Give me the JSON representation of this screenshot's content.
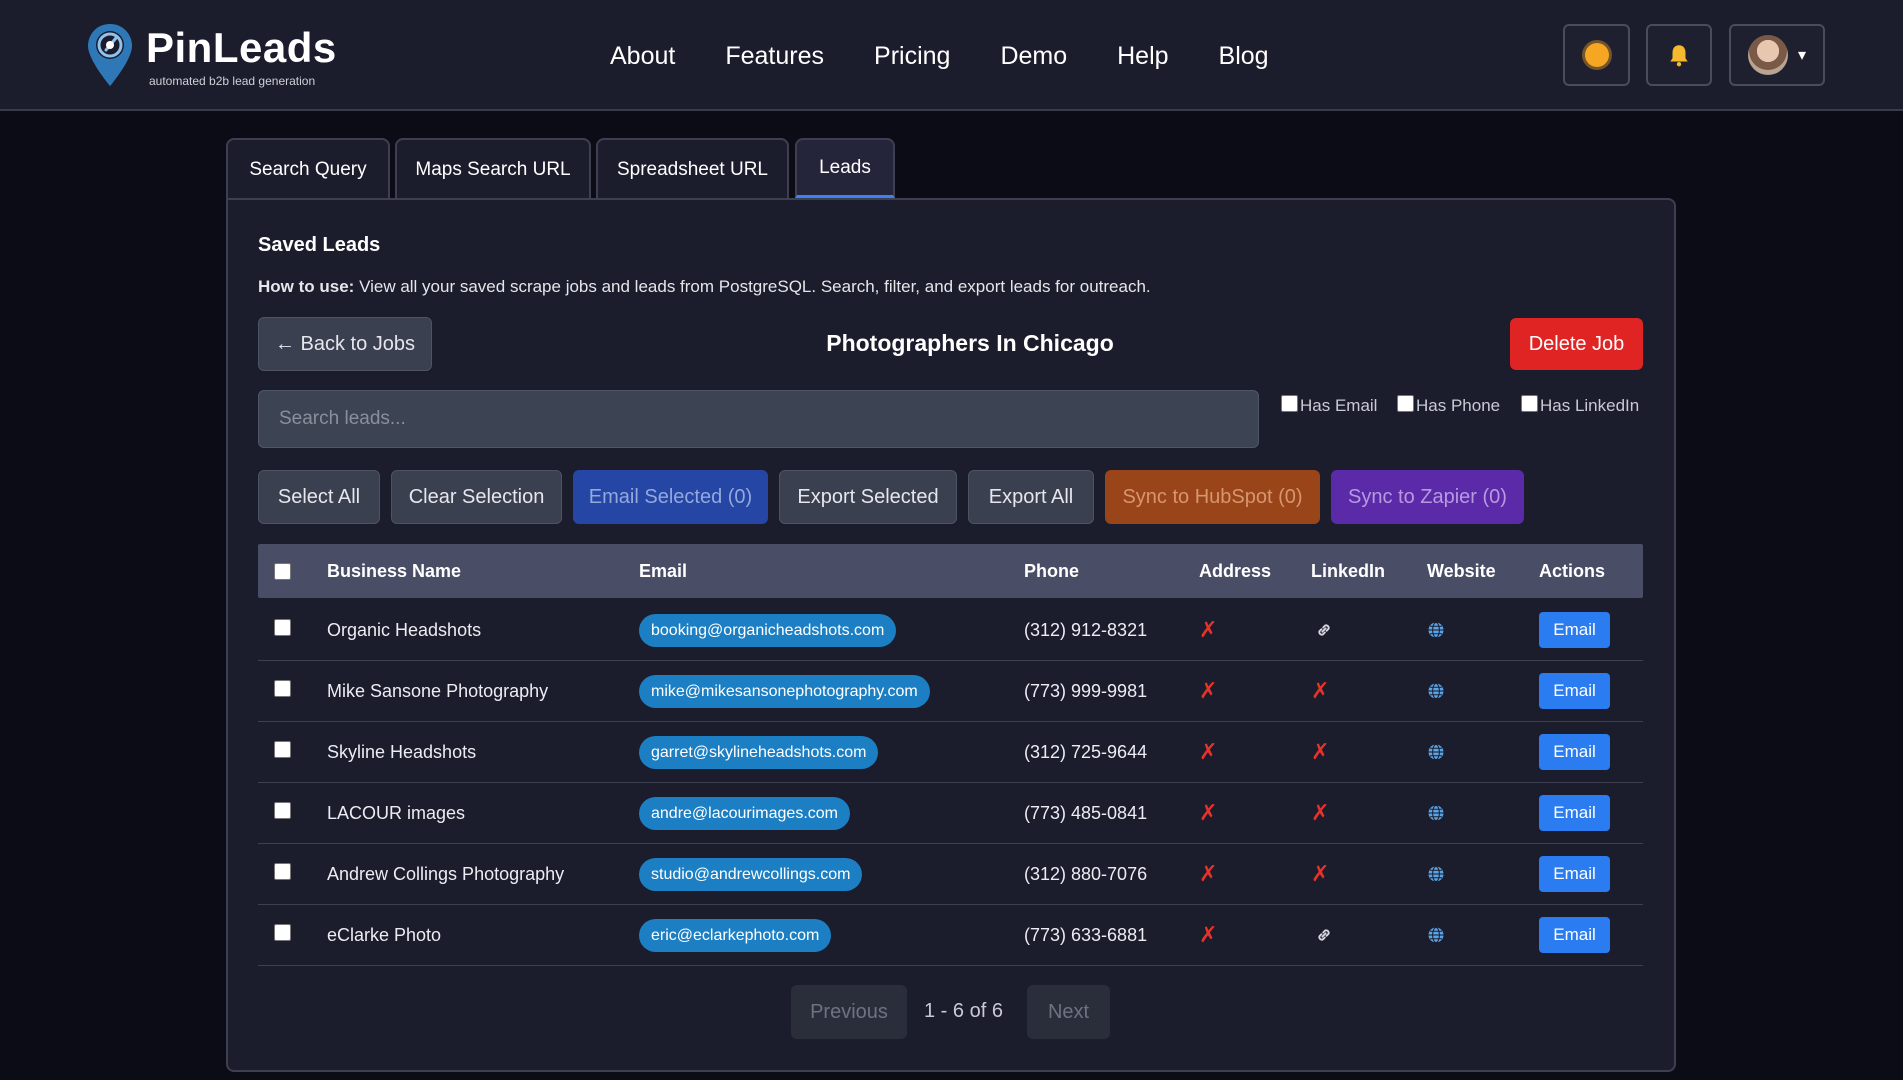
{
  "brand": {
    "name": "PinLeads",
    "tagline": "automated b2b lead generation"
  },
  "nav": [
    "About",
    "Features",
    "Pricing",
    "Demo",
    "Help",
    "Blog"
  ],
  "header_icons": {
    "theme": "sun-icon",
    "notifications": "bell-icon",
    "user_caret": "▾"
  },
  "tabs": [
    {
      "label": "Search Query"
    },
    {
      "label": "Maps Search URL"
    },
    {
      "label": "Spreadsheet URL"
    },
    {
      "label": "Leads",
      "active": true
    }
  ],
  "panel": {
    "title": "Saved Leads",
    "howto_label": "How to use:",
    "howto_text": " View all your saved scrape jobs and leads from PostgreSQL. Search, filter, and export leads for outreach.",
    "back_label": "← Back to Jobs",
    "job_title": "Photographers In Chicago",
    "delete_label": "Delete Job"
  },
  "search": {
    "placeholder": "Search leads...",
    "value": ""
  },
  "filters": [
    {
      "label": "Has Email",
      "checked": false
    },
    {
      "label": "Has Phone",
      "checked": false
    },
    {
      "label": "Has LinkedIn",
      "checked": false
    }
  ],
  "actions": {
    "select_all": "Select All",
    "clear_selection": "Clear Selection",
    "email_selected": "Email Selected (0)",
    "export_selected": "Export Selected",
    "export_all": "Export All",
    "sync_hubspot": "Sync to HubSpot (0)",
    "sync_zapier": "Sync to Zapier (0)"
  },
  "table": {
    "columns": [
      "Business Name",
      "Email",
      "Phone",
      "Address",
      "LinkedIn",
      "Website",
      "Actions"
    ],
    "rows": [
      {
        "business": "Organic Headshots",
        "email": "booking@organicheadshots.com",
        "phone": "(312) 912-8321",
        "address": "✗",
        "linkedin": "link-icon",
        "website": "globe-icon",
        "action": "Email"
      },
      {
        "business": "Mike Sansone Photography",
        "email": "mike@mikesansonephotography.com",
        "phone": "(773) 999-9981",
        "address": "✗",
        "linkedin": "✗",
        "website": "globe-icon",
        "action": "Email"
      },
      {
        "business": "Skyline Headshots",
        "email": "garret@skylineheadshots.com",
        "phone": "(312) 725-9644",
        "address": "✗",
        "linkedin": "✗",
        "website": "globe-icon",
        "action": "Email"
      },
      {
        "business": "LACOUR images",
        "email": "andre@lacourimages.com",
        "phone": "(773) 485-0841",
        "address": "✗",
        "linkedin": "✗",
        "website": "globe-icon",
        "action": "Email"
      },
      {
        "business": "Andrew Collings Photography",
        "email": "studio@andrewcollings.com",
        "phone": "(312) 880-7076",
        "address": "✗",
        "linkedin": "✗",
        "website": "globe-icon",
        "action": "Email"
      },
      {
        "business": "eClarke Photo",
        "email": "eric@eclarkephoto.com",
        "phone": "(773) 633-6881",
        "address": "✗",
        "linkedin": "link-icon",
        "website": "globe-icon",
        "action": "Email"
      }
    ]
  },
  "pagination": {
    "previous": "Previous",
    "info": "1 - 6 of 6",
    "next": "Next"
  },
  "colors": {
    "accent": "#3b82f6",
    "danger": "#e02424",
    "hubspot": "#9a4419",
    "zapier": "#5b2aa8",
    "email_pill": "#1c7fc4"
  }
}
